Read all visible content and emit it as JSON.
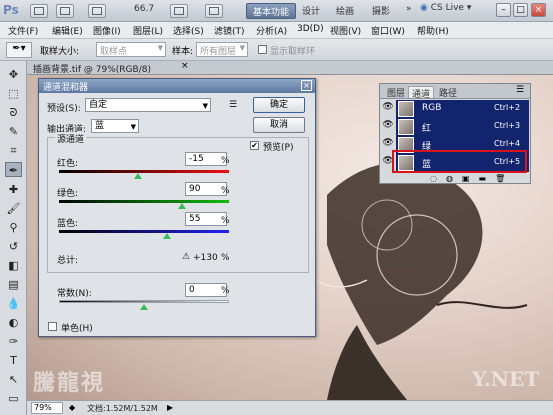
{
  "app": {
    "logo": "Ps",
    "zoom": "66.7",
    "workspace_active": "基本功能",
    "workspaces": [
      "设计",
      "绘画",
      "摄影"
    ],
    "more": "»",
    "cs_live": "CS Live"
  },
  "menu": [
    "文件(F)",
    "编辑(E)",
    "图像(I)",
    "图层(L)",
    "选择(S)",
    "滤镜(T)",
    "分析(A)",
    "3D(D)",
    "视图(V)",
    "窗口(W)",
    "帮助(H)"
  ],
  "options": {
    "sample_size_label": "取样大小:",
    "sample_size_value": "取样点",
    "sample_label": "样本:",
    "sample_value": "所有图层",
    "show_ring": "显示取样环"
  },
  "document": {
    "tab_title": "插画背景.tif @ 79%(RGB/8)",
    "zoom": "79%",
    "doc_info": "文档:1.52M/1.52M"
  },
  "watermark": "騰龍視",
  "watermark_right": "Y.NET",
  "channels_panel": {
    "tabs": [
      "图层",
      "通道",
      "路径"
    ],
    "rows": [
      {
        "name": "RGB",
        "shortcut": "Ctrl+2"
      },
      {
        "name": "红",
        "shortcut": "Ctrl+3"
      },
      {
        "name": "绿",
        "shortcut": "Ctrl+4"
      },
      {
        "name": "蓝",
        "shortcut": "Ctrl+5"
      }
    ]
  },
  "dialog": {
    "title": "通道混和器",
    "preset_label": "预设(S):",
    "preset_value": "自定",
    "output_label": "输出通道:",
    "output_value": "蓝",
    "source_group": "源通道",
    "red_label": "红色:",
    "red_value": "-15",
    "red": -15,
    "green_label": "绿色:",
    "green_value": "90",
    "green": 90,
    "blue_label": "蓝色:",
    "blue_value": "55",
    "blue": 55,
    "total_label": "总计:",
    "total_value": "+130",
    "pct": "%",
    "warn": "⚠",
    "constant_label": "常数(N):",
    "constant_value": "0",
    "constant": 0,
    "mono_label": "单色(H)",
    "ok": "确定",
    "cancel": "取消",
    "preview": "预览(P)",
    "menu_glyph": "☰"
  },
  "colors": {
    "selected": "#13246e",
    "highlight": "#d8141a",
    "slider_thumb": "#3bbc5b"
  }
}
